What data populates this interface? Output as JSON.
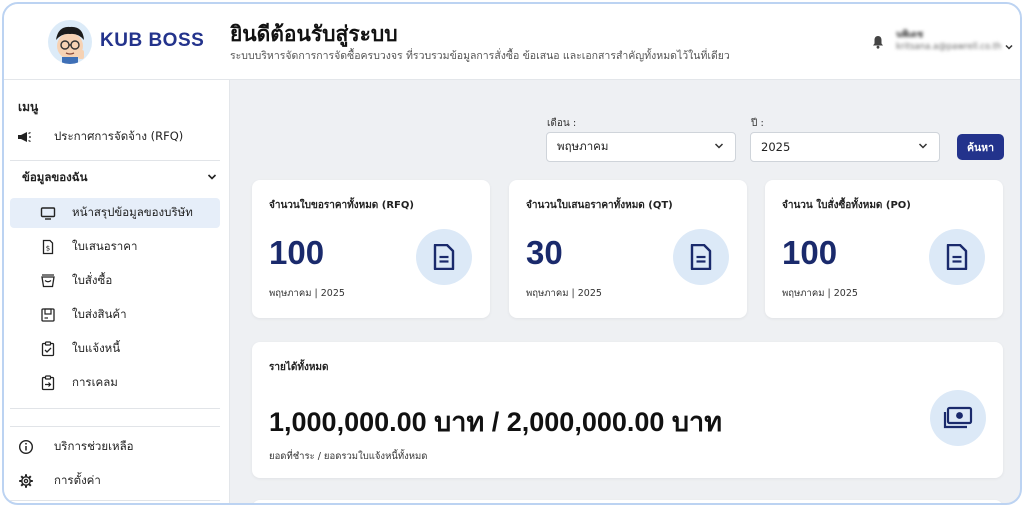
{
  "brand": {
    "name": "KUB BOSS"
  },
  "header": {
    "title": "ยินดีต้อนรับสู่ระบบ",
    "subtitle": "ระบบบริหารจัดการการจัดซื้อครบวงจร ที่รวบรวมข้อมูลการสั่งซื้อ ข้อเสนอ และเอกสารสำคัญทั้งหมดไว้ในที่เดียว",
    "user_name": "นพิเดช",
    "user_email": "kritsana.a@pawrell.co.th"
  },
  "sidebar": {
    "menu_label": "เมนู",
    "rfq_item": "ประกาศการจัดจ้าง (RFQ)",
    "section_label": "ข้อมูลของฉัน",
    "items": [
      {
        "label": "หน้าสรุปข้อมูลของบริษัท",
        "icon": "monitor-icon"
      },
      {
        "label": "ใบเสนอราคา",
        "icon": "quote-document-icon"
      },
      {
        "label": "ใบสั่งซื้อ",
        "icon": "basket-icon"
      },
      {
        "label": "ใบส่งสินค้า",
        "icon": "delivery-box-icon"
      },
      {
        "label": "ใบแจ้งหนี้",
        "icon": "invoice-clipboard-icon"
      },
      {
        "label": "การเคลม",
        "icon": "claim-icon"
      }
    ],
    "help": "บริการช่วยเหลือ",
    "settings": "การตั้งค่า"
  },
  "filters": {
    "month_label": "เดือน :",
    "month_value": "พฤษภาคม",
    "year_label": "ปี :",
    "year_value": "2025",
    "search_button": "ค้นหา"
  },
  "cards": [
    {
      "title": "จำนวนใบขอราคาทั้งหมด (RFQ)",
      "value": "100",
      "period": "พฤษภาคม | 2025",
      "icon": "document-icon"
    },
    {
      "title": "จำนวนใบเสนอราคาทั้งหมด (QT)",
      "value": "30",
      "period": "พฤษภาคม | 2025",
      "icon": "document-icon"
    },
    {
      "title": "จำนวน ใบสั่งซื้อทั้งหมด (PO)",
      "value": "100",
      "period": "พฤษภาคม | 2025",
      "icon": "document-icon"
    }
  ],
  "revenue": {
    "title": "รายได้ทั้งหมด",
    "value": "1,000,000.00 บาท / 2,000,000.00 บาท",
    "caption": "ยอดที่ชำระ / ยอดรวมใบแจ้งหนี้ทั้งหมด",
    "icon": "money-icon"
  },
  "colors": {
    "brand": "#23338c",
    "accent_bg": "#dce9f7",
    "active_nav": "#e6eef9"
  }
}
